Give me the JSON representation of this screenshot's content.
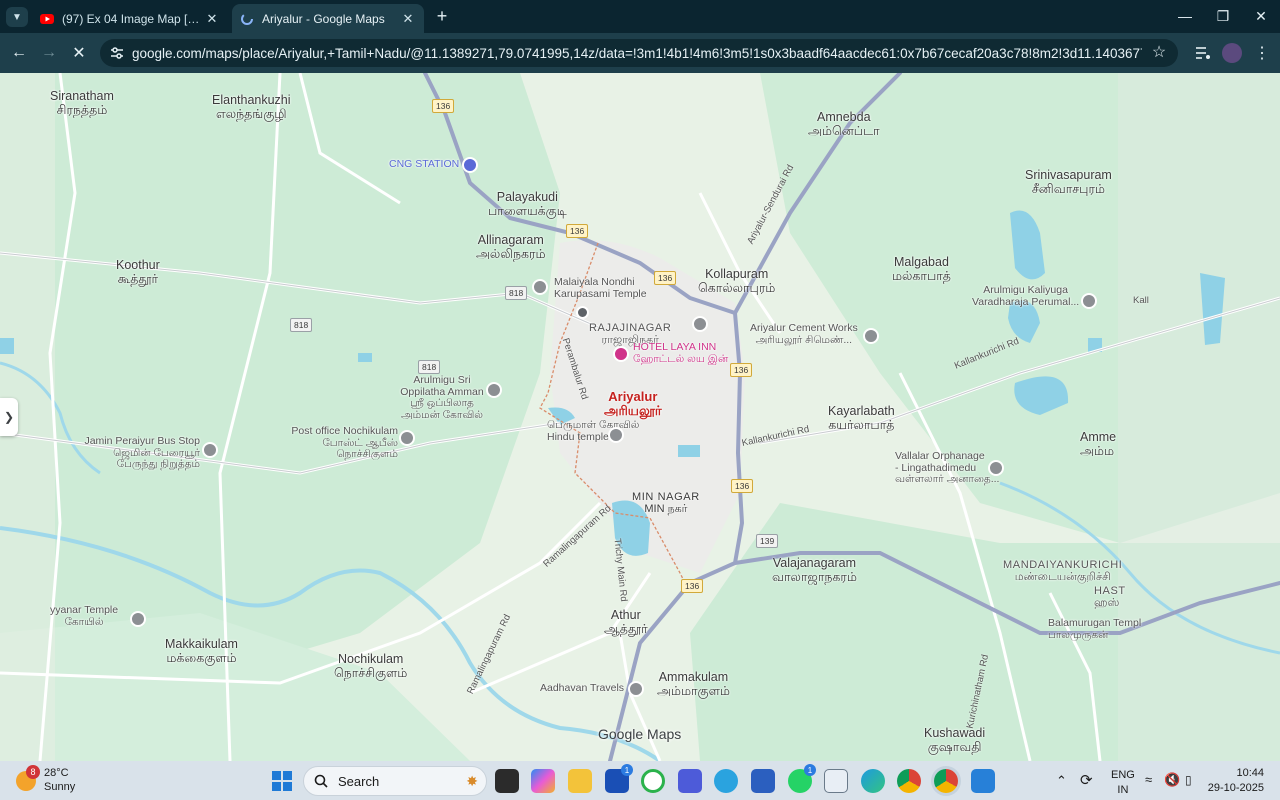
{
  "browser": {
    "tabs": [
      {
        "title": "(97) Ex 04 Image Map [English V",
        "active": false
      },
      {
        "title": "Ariyalur - Google Maps",
        "active": true
      }
    ],
    "url": "google.com/maps/place/Ariyalur,+Tamil+Nadu/@11.1389271,79.0741995,14z/data=!3m1!4b1!4m6!3m5!1s0x3baadf64aacdec61:0x7b67cecaf20a3c78!8m2!3d11.1403677!4d79.07445!16zL20vMGZ...",
    "window_controls": [
      "minimize",
      "maximize",
      "close"
    ]
  },
  "map": {
    "brand": "Google Maps",
    "places": [
      {
        "en": "Siranatham",
        "ta": "சிரநத்தம்"
      },
      {
        "en": "Elanthankuzhi",
        "ta": "எலந்தங்குழி"
      },
      {
        "en": "Amnebda",
        "ta": "அம்னெப்டா"
      },
      {
        "en": "Palayakudi",
        "ta": "பாளையக்குடி"
      },
      {
        "en": "Allinagaram",
        "ta": "அல்லிநகரம்"
      },
      {
        "en": "Srinivasapuram",
        "ta": "சீனிவாசபுரம்"
      },
      {
        "en": "Koothur",
        "ta": "கூத்தூர்"
      },
      {
        "en": "Kollapuram",
        "ta": "கொல்லாபுரம்"
      },
      {
        "en": "Malgabad",
        "ta": "மல்காபாத்"
      },
      {
        "en": "Ariyalur",
        "ta": "அரியலூர்"
      },
      {
        "en": "Kayarlabath",
        "ta": "கயர்லாபாத்"
      },
      {
        "en": "Amme",
        "ta": "அம்ம"
      },
      {
        "en": "MIN NAGAR",
        "ta": "MIN நகர்"
      },
      {
        "en": "Valajanagaram",
        "ta": "வாலாஜாநகரம்"
      },
      {
        "en": "Athur",
        "ta": "ஆத்தூர்"
      },
      {
        "en": "Makkaikulam",
        "ta": "மக்கைகுளம்"
      },
      {
        "en": "Nochikulam",
        "ta": "நொச்சிகுளம்"
      },
      {
        "en": "Ammakulam",
        "ta": "அம்மாகுளம்"
      },
      {
        "en": "Kushawadi",
        "ta": "குஷாவதி"
      },
      {
        "en": "RAJAJINAGAR",
        "ta": "ராஜாஜிநகர்"
      },
      {
        "en": "MANDAIYANKURICHI",
        "ta": "மண்டையன்குறிச்சி"
      },
      {
        "en": "HAST",
        "ta": "ஹஸ்"
      }
    ],
    "pois": [
      {
        "en": "CNG STATION",
        "ta": ""
      },
      {
        "en": "Malaiyala Nondhi",
        "ta": "Karupasami Temple"
      },
      {
        "en": "HOTEL LAYA INN",
        "ta": "ஹோட்டல் லய இன்"
      },
      {
        "en": "Ariyalur Cement Works",
        "ta": "அரியலூர் சிமெண்..."
      },
      {
        "en": "Arulmigu Kaliyuga",
        "ta": "Varadharaja Perumal..."
      },
      {
        "en": "Arulmigu Sri Oppilatha Amman",
        "ta": "ஸ்ரீ ஒப்பிலாத அம்மன் கோவில்"
      },
      {
        "en": "Post office Nochikulam",
        "ta": "போஸ்ட் ஆபீஸ் நொச்சிகுளம்"
      },
      {
        "en": "Jamin Peraiyur Bus Stop",
        "ta": "ஜெமின் பேரையூர் பேருந்து நிறுத்தம்"
      },
      {
        "en": "பெருமாள் கோவில்",
        "ta": "Hindu temple"
      },
      {
        "en": "Vallalar Orphanage - Lingathadimedu",
        "ta": "வள்ளலார் அனாதை..."
      },
      {
        "en": "Balamurugan Templ",
        "ta": "பாலமுருகன்"
      },
      {
        "en": "Aadhavan Travels",
        "ta": ""
      },
      {
        "en": "yyanar Temple",
        "ta": "கோயில்"
      }
    ],
    "roads": {
      "shields": [
        "136",
        "136",
        "136",
        "136",
        "136",
        "136",
        "818",
        "818",
        "818",
        "139"
      ],
      "names": [
        "Ariyalur-Sendurai Rd",
        "Perambalur Rd",
        "Kallankurichi Rd",
        "Kallankurichi Rd",
        "Ramalingapuram Rd",
        "Trichy Main Rd",
        "Ramalingapuram Rd",
        "Kurichinatham Rd",
        "Kall"
      ]
    }
  },
  "taskbar": {
    "weather": {
      "temp": "28°C",
      "condition": "Sunny",
      "badge": "8"
    },
    "search_placeholder": "Search",
    "tray": {
      "lang1": "ENG",
      "lang2": "IN"
    },
    "clock": {
      "time": "10:44",
      "date": "29-10-2025"
    },
    "app_badges": [
      "1",
      "1"
    ]
  },
  "colors": {
    "tabbar": "#0b2530",
    "toolbar": "#1e3f4b",
    "map_green": "#cdebd6",
    "highway": "#9aa3c4",
    "water": "#8fd1e6",
    "taskbar": "#d9e2ea"
  }
}
